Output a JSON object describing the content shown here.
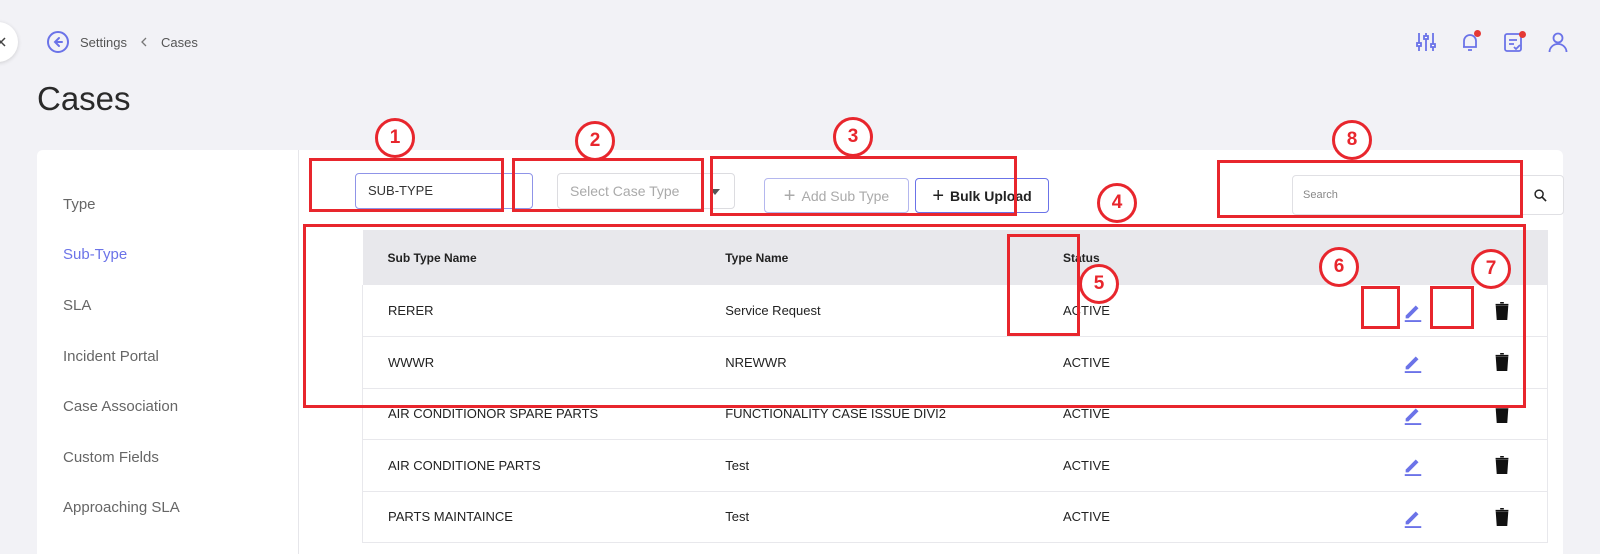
{
  "breadcrumb": {
    "parent": "Settings",
    "current": "Cases"
  },
  "page_title": "Cases",
  "sidebar": {
    "items": [
      {
        "label": "Type",
        "active": false
      },
      {
        "label": "Sub-Type",
        "active": true
      },
      {
        "label": "SLA",
        "active": false
      },
      {
        "label": "Incident Portal",
        "active": false
      },
      {
        "label": "Case Association",
        "active": false
      },
      {
        "label": "Custom Fields",
        "active": false
      },
      {
        "label": "Approaching SLA",
        "active": false
      }
    ]
  },
  "toolbar": {
    "subtype_value": "SUB-TYPE",
    "case_type_placeholder": "Select Case Type",
    "add_sub_type_label": "Add Sub Type",
    "bulk_upload_label": "Bulk Upload",
    "search_placeholder": "Search"
  },
  "table": {
    "columns": [
      "Sub Type Name",
      "Type Name",
      "Status"
    ],
    "rows": [
      {
        "sub_type": "RERER",
        "type": "Service Request",
        "status": "ACTIVE"
      },
      {
        "sub_type": "WWWR",
        "type": "NREWWR",
        "status": "ACTIVE"
      },
      {
        "sub_type": "AIR CONDITIONOR SPARE PARTS",
        "type": "FUNCTIONALITY CASE ISSUE DIVI2",
        "status": "ACTIVE"
      },
      {
        "sub_type": "AIR CONDITIONE PARTS",
        "type": "Test",
        "status": "ACTIVE"
      },
      {
        "sub_type": "PARTS MAINTAINCE",
        "type": "Test",
        "status": "ACTIVE"
      }
    ]
  },
  "annotations": [
    "1",
    "2",
    "3",
    "4",
    "5",
    "6",
    "7",
    "8"
  ],
  "colors": {
    "accent": "#6b73e8",
    "annotation": "#e8262d",
    "notification_dot": "#e53935"
  },
  "icons": [
    "back-icon",
    "chevron-left-icon",
    "filter-sliders-icon",
    "bell-alert-icon",
    "task-check-icon",
    "user-icon",
    "search-icon",
    "edit-icon",
    "trash-icon"
  ]
}
